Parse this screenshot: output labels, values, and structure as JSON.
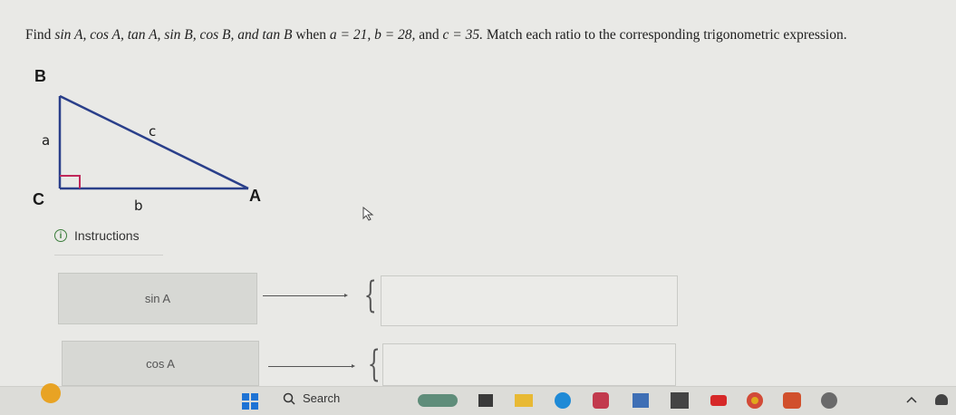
{
  "question": {
    "prefix": "Find",
    "functions": "sin A, cos A, tan A, sin B, cos B, and tan B",
    "when": "when",
    "a": "a = 21, b = 28,",
    "and": "and",
    "c": "c = 35.",
    "instruction": "Match each ratio to the corresponding trigonometric expression."
  },
  "triangle": {
    "vertex_b": "B",
    "vertex_c": "C",
    "vertex_a": "A",
    "side_a": "a",
    "side_b": "b",
    "side_c": "c"
  },
  "instructions_label": "Instructions",
  "rows": [
    {
      "label": "sin A",
      "answer": ""
    },
    {
      "label": "cos A",
      "answer": ""
    }
  ],
  "taskbar": {
    "search_label": "Search",
    "icons": [
      "weather-icon",
      "windows-start-icon",
      "search-icon",
      "widgets-icon",
      "terminal-icon",
      "file-explorer-icon",
      "edge-icon",
      "photo-icon",
      "store-icon",
      "xbox-icon",
      "youtube-icon",
      "chrome-icon",
      "office-icon",
      "settings-icon",
      "chevron-up-icon",
      "notification-icon"
    ]
  }
}
